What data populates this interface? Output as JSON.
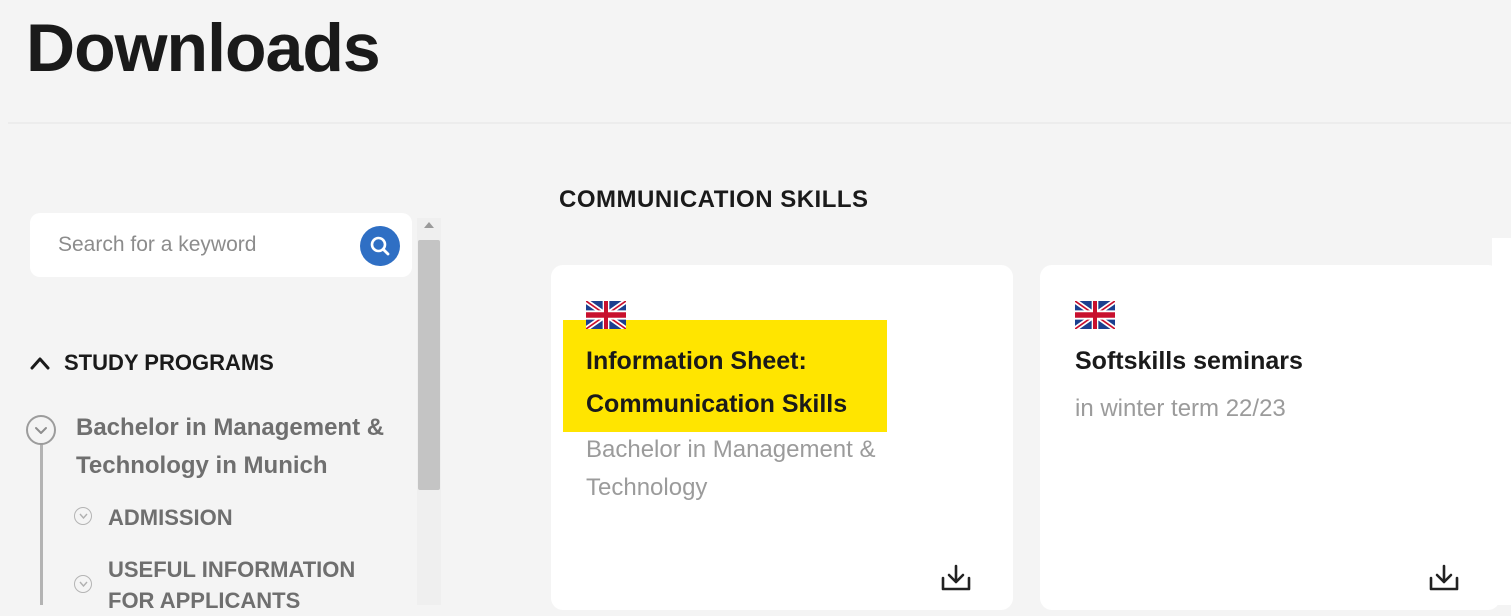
{
  "page": {
    "title": "Downloads"
  },
  "sidebar": {
    "search": {
      "placeholder": "Search for a keyword",
      "icon": "search-icon"
    },
    "section": {
      "label": "STUDY PROGRAMS",
      "expanded": true,
      "icon": "chevron-up-icon"
    },
    "program": {
      "label": "Bachelor in Management & Technology in Munich",
      "icon": "chevron-down-icon"
    },
    "sub_items": [
      {
        "label": "ADMISSION",
        "icon": "chevron-down-icon"
      },
      {
        "label": "USEFUL INFORMATION FOR APPLICANTS",
        "icon": "chevron-down-icon"
      }
    ]
  },
  "main": {
    "category": "COMMUNICATION SKILLS",
    "cards": [
      {
        "flag": "uk-flag-icon",
        "title_line1": "Information Sheet:",
        "title_line2": "Communication Skills",
        "subtitle_line1": "Bachelor in Management &",
        "subtitle_line2": "Technology",
        "highlighted": true,
        "highlight_color": "#ffe500",
        "action_icon": "download-icon"
      },
      {
        "flag": "uk-flag-icon",
        "title_line1": "Softskills seminars",
        "subtitle_line1": "in winter term 22/23",
        "highlighted": false,
        "action_icon": "download-icon"
      }
    ]
  },
  "colors": {
    "background": "#f4f4f4",
    "accent_blue": "#2f6fc4",
    "highlight_yellow": "#ffe500"
  }
}
